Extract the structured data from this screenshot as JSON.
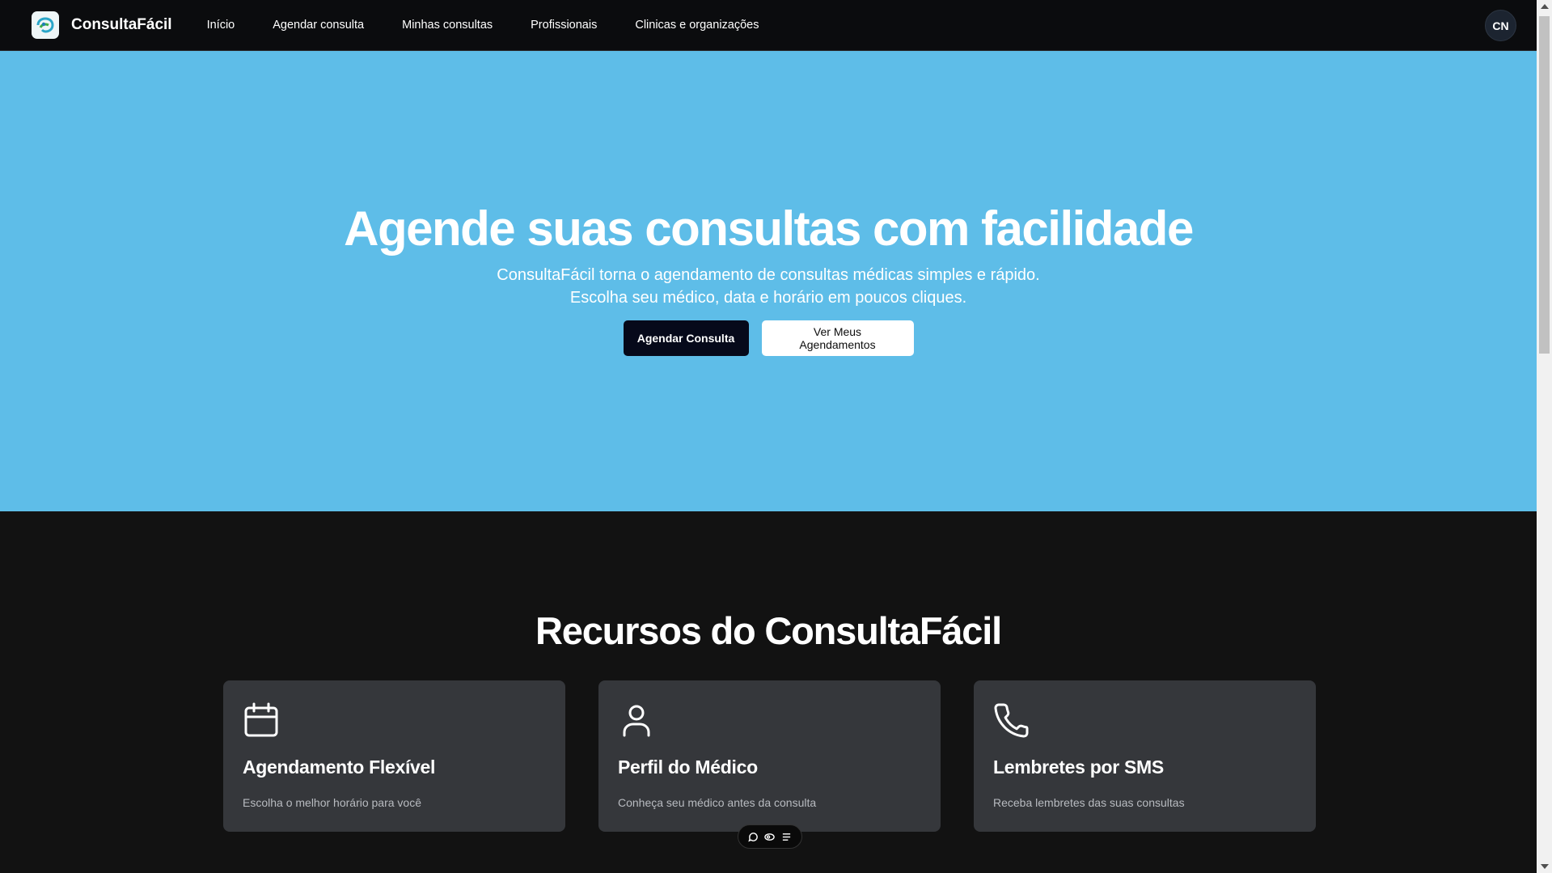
{
  "navbar": {
    "brand": "ConsultaFácil",
    "links": [
      "Início",
      "Agendar consulta",
      "Minhas consultas",
      "Profissionais",
      "Clinicas e organizações"
    ],
    "avatar_initials": "CN"
  },
  "hero": {
    "title": "Agende suas consultas com facilidade",
    "subtitle_line1": "ConsultaFácil torna o agendamento de consultas médicas simples e rápido.",
    "subtitle_line2": "Escolha seu médico, data e horário em poucos cliques.",
    "primary_button": "Agendar Consulta",
    "secondary_button": "Ver Meus Agendamentos",
    "background_color": "#5ebde8"
  },
  "features": {
    "title": "Recursos do ConsultaFácil",
    "cards": [
      {
        "icon": "calendar-icon",
        "title": "Agendamento Flexível",
        "description": "Escolha o melhor horário para você"
      },
      {
        "icon": "user-icon",
        "title": "Perfil do Médico",
        "description": "Conheça seu médico antes da consulta"
      },
      {
        "icon": "phone-icon",
        "title": "Lembretes por SMS",
        "description": "Receba lembretes das suas consultas"
      }
    ]
  },
  "floating_toolbar": {
    "icons": [
      "chat-icon",
      "eye-icon",
      "list-icon"
    ]
  }
}
